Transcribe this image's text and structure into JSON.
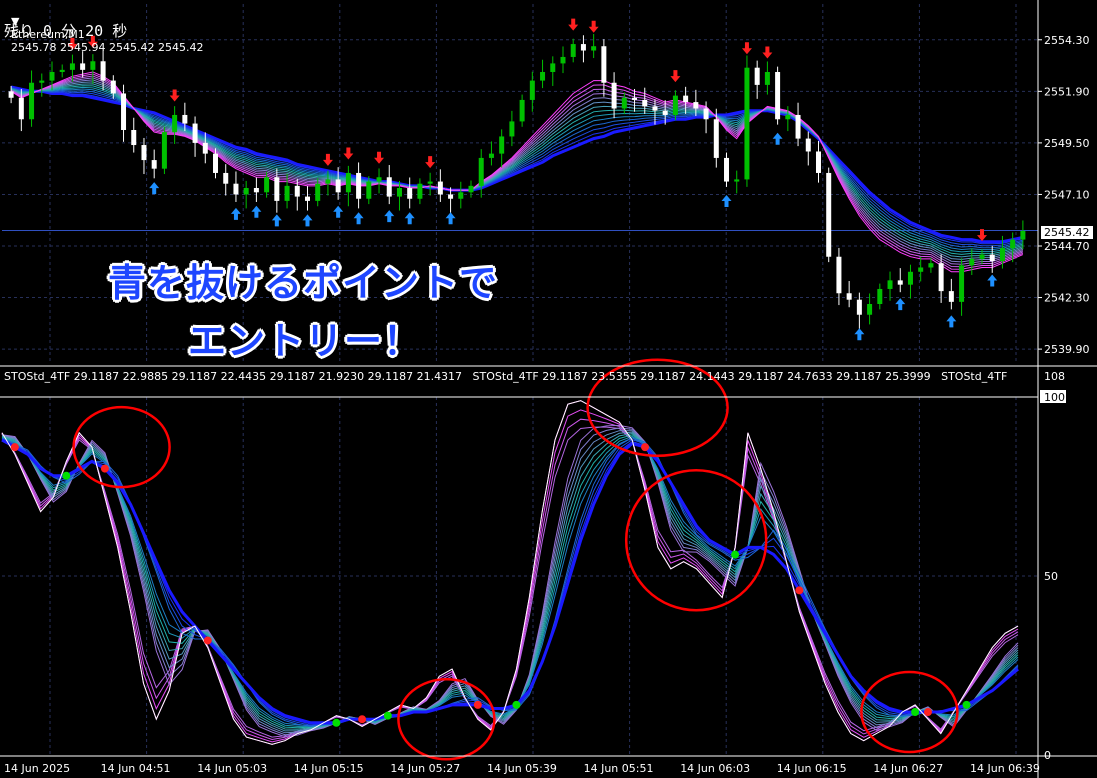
{
  "header": {
    "symbol": "Ethereum,M1",
    "ohlc": "2545.78 2545.94 2545.42 2545.42",
    "countdown": "残り 0 分 20 秒"
  },
  "annotation": {
    "line1": "青を抜けるポイントで",
    "line2": "エントリー！"
  },
  "indicator_header": "STOStd_4TF 29.1187 22.9885 29.1187 22.4435 29.1187 21.9230 29.1187 21.4317   STOStd_4TF 29.1187 23.5355 29.1187 24.1443 29.1187 24.7633 29.1187 25.3999   STOStd_4TF",
  "current_price": "2545.42",
  "colors": {
    "background": "#000000",
    "grid": "#27305a",
    "bull": "#00c000",
    "bear": "#ffffff",
    "buy_arrow": "#1e90ff",
    "sell_arrow": "#ff2020",
    "circle": "#ff0000",
    "ribbon_slow": "#1a1aff",
    "ribbon_mid": "#20b2aa",
    "ribbon_fast": "#ff40ff"
  },
  "chart_data": [
    {
      "type": "candlestick",
      "title": "Ethereum,M1",
      "y_ticks": [
        "2554.30",
        "2551.90",
        "2549.50",
        "2547.10",
        "2544.70",
        "2542.30",
        "2539.90"
      ],
      "ylim": [
        2539.3,
        2555.5
      ],
      "x_ticks": [
        "14 Jun 2025",
        "14 Jun 04:51",
        "14 Jun 05:03",
        "14 Jun 05:15",
        "14 Jun 05:27",
        "14 Jun 05:39",
        "14 Jun 05:51",
        "14 Jun 06:03",
        "14 Jun 06:15",
        "14 Jun 06:27",
        "14 Jun 06:39"
      ],
      "close": [
        2551.6,
        2550.6,
        2552.3,
        2552.4,
        2552.8,
        2552.9,
        2553.2,
        2552.9,
        2553.3,
        2552.4,
        2551.8,
        2550.1,
        2549.4,
        2548.7,
        2548.3,
        2550.0,
        2550.8,
        2550.4,
        2549.5,
        2549.0,
        2548.1,
        2547.6,
        2547.1,
        2547.4,
        2547.2,
        2547.9,
        2546.8,
        2547.5,
        2547.0,
        2546.8,
        2547.6,
        2547.8,
        2547.2,
        2548.1,
        2546.9,
        2547.7,
        2547.9,
        2547.0,
        2547.4,
        2546.9,
        2547.6,
        2547.7,
        2547.1,
        2546.9,
        2547.2,
        2547.5,
        2548.8,
        2549.0,
        2549.8,
        2550.5,
        2551.5,
        2552.4,
        2552.8,
        2553.2,
        2553.5,
        2554.1,
        2553.8,
        2554.0,
        2552.3,
        2551.1,
        2551.6,
        2551.5,
        2551.2,
        2551.0,
        2550.8,
        2551.7,
        2551.4,
        2551.1,
        2550.6,
        2548.8,
        2547.7,
        2547.8,
        2553.0,
        2552.2,
        2552.8,
        2550.6,
        2550.8,
        2549.7,
        2549.1,
        2548.1,
        2544.2,
        2542.5,
        2542.2,
        2541.5,
        2542.0,
        2542.7,
        2543.1,
        2542.9,
        2543.5,
        2543.7,
        2543.9,
        2542.6,
        2542.1,
        2543.8,
        2544.1,
        2544.3,
        2544.0,
        2544.6,
        2545.0,
        2545.4
      ],
      "series": [
        {
          "name": "MA ribbon slow",
          "values": [
            2552.1,
            2552.0,
            2551.9,
            2551.9,
            2551.8,
            2551.8,
            2551.7,
            2551.7,
            2551.6,
            2551.5,
            2551.4,
            2551.3,
            2551.1,
            2551.0,
            2550.9,
            2550.7,
            2550.5,
            2550.3,
            2550.1,
            2549.9,
            2549.7,
            2549.5,
            2549.3,
            2549.2,
            2549.0,
            2548.9,
            2548.8,
            2548.7,
            2548.5,
            2548.4,
            2548.3,
            2548.2,
            2548.1,
            2548.0,
            2547.9,
            2547.8,
            2547.7,
            2547.7,
            2547.6,
            2547.5,
            2547.5,
            2547.4,
            2547.4,
            2547.3,
            2547.3,
            2547.3,
            2547.4,
            2547.6,
            2547.8,
            2548.0,
            2548.2,
            2548.4,
            2548.6,
            2548.9,
            2549.1,
            2549.3,
            2549.5,
            2549.7,
            2549.8,
            2550.0,
            2550.1,
            2550.2,
            2550.3,
            2550.4,
            2550.5,
            2550.6,
            2550.6,
            2550.7,
            2550.7,
            2550.8,
            2550.8,
            2550.9,
            2551.0,
            2551.0,
            2551.0,
            2550.9,
            2550.8,
            2550.5,
            2550.1,
            2549.7,
            2549.2,
            2548.7,
            2548.2,
            2547.7,
            2547.2,
            2546.8,
            2546.4,
            2546.1,
            2545.8,
            2545.6,
            2545.4,
            2545.2,
            2545.1,
            2545.0,
            2545.0,
            2544.9,
            2544.9,
            2544.9,
            2545.0,
            2545.1
          ]
        },
        {
          "name": "MA ribbon fast",
          "values": [
            2551.9,
            2551.6,
            2551.8,
            2552.0,
            2552.2,
            2552.4,
            2552.6,
            2552.7,
            2552.8,
            2552.6,
            2552.3,
            2551.7,
            2551.1,
            2550.5,
            2550.0,
            2549.9,
            2549.9,
            2549.8,
            2549.6,
            2549.3,
            2549.0,
            2548.6,
            2548.3,
            2548.1,
            2547.9,
            2547.9,
            2547.7,
            2547.7,
            2547.6,
            2547.5,
            2547.5,
            2547.6,
            2547.5,
            2547.6,
            2547.5,
            2547.5,
            2547.6,
            2547.5,
            2547.5,
            2547.4,
            2547.4,
            2547.5,
            2547.4,
            2547.3,
            2547.3,
            2547.3,
            2547.7,
            2548.0,
            2548.4,
            2548.8,
            2549.3,
            2549.8,
            2550.3,
            2550.8,
            2551.3,
            2551.8,
            2552.1,
            2552.4,
            2552.4,
            2552.2,
            2552.1,
            2551.9,
            2551.8,
            2551.6,
            2551.4,
            2551.5,
            2551.4,
            2551.3,
            2551.2,
            2550.7,
            2550.1,
            2549.7,
            2550.4,
            2550.8,
            2551.2,
            2551.1,
            2551.0,
            2550.7,
            2550.3,
            2549.8,
            2548.8,
            2547.8,
            2546.9,
            2546.1,
            2545.5,
            2545.0,
            2544.7,
            2544.4,
            2544.2,
            2544.1,
            2544.1,
            2543.8,
            2543.5,
            2543.5,
            2543.6,
            2543.7,
            2543.7,
            2543.9,
            2544.1,
            2544.3
          ]
        }
      ]
    },
    {
      "type": "line",
      "title": "STOStd_4TF",
      "y_ticks": [
        "108",
        "100",
        "50",
        "0"
      ],
      "ylim": [
        0,
        108
      ],
      "x_ticks": [
        "14 Jun 2025",
        "14 Jun 04:51",
        "14 Jun 05:03",
        "14 Jun 05:15",
        "14 Jun 05:27",
        "14 Jun 05:39",
        "14 Jun 05:51",
        "14 Jun 06:03",
        "14 Jun 06:15",
        "14 Jun 06:27",
        "14 Jun 06:39"
      ],
      "series": [
        {
          "name": "fast",
          "values": [
            90,
            84,
            76,
            68,
            72,
            82,
            90,
            86,
            72,
            58,
            40,
            20,
            10,
            18,
            34,
            36,
            30,
            20,
            10,
            5,
            4,
            3,
            4,
            6,
            7,
            9,
            11,
            10,
            8,
            10,
            12,
            14,
            13,
            16,
            22,
            24,
            16,
            10,
            7,
            12,
            24,
            44,
            68,
            88,
            98,
            99,
            97,
            95,
            93,
            88,
            74,
            58,
            52,
            54,
            52,
            48,
            44,
            58,
            90,
            80,
            68,
            54,
            40,
            30,
            20,
            12,
            6,
            4,
            6,
            8,
            12,
            14,
            10,
            6,
            12,
            18,
            24,
            30,
            34,
            36
          ]
        },
        {
          "name": "slow",
          "values": [
            88,
            86,
            84,
            80,
            78,
            78,
            80,
            82,
            80,
            76,
            70,
            62,
            54,
            46,
            40,
            36,
            32,
            28,
            24,
            20,
            16,
            13,
            11,
            10,
            9,
            9,
            9,
            10,
            10,
            10,
            11,
            11,
            12,
            12,
            13,
            14,
            14,
            14,
            13,
            13,
            14,
            18,
            26,
            36,
            48,
            60,
            70,
            78,
            84,
            87,
            86,
            82,
            76,
            70,
            64,
            60,
            58,
            56,
            58,
            58,
            56,
            52,
            46,
            40,
            34,
            28,
            22,
            18,
            15,
            13,
            12,
            12,
            12,
            12,
            13,
            14,
            16,
            18,
            21,
            24
          ]
        }
      ],
      "entry_points": [
        {
          "x": "14 Jun 04:51",
          "y": 86
        },
        {
          "x": "14 Jun 05:27",
          "y": 10
        },
        {
          "x": "14 Jun 05:51",
          "y": 97
        },
        {
          "x": "14 Jun 06:03",
          "y": 60
        },
        {
          "x": "14 Jun 06:27",
          "y": 12
        }
      ]
    }
  ]
}
